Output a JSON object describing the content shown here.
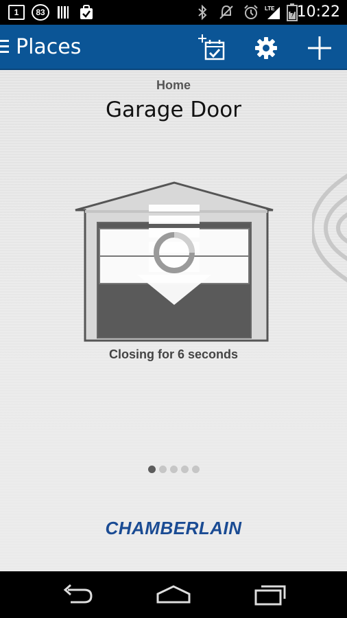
{
  "status_bar": {
    "calendar_day": "1",
    "notification_count": "83",
    "network_label": "LTE",
    "time": "10:22"
  },
  "action_bar": {
    "title": "Places"
  },
  "main": {
    "place_name": "Home",
    "device_name": "Garage Door",
    "status_message": "Closing for 6 seconds",
    "door_state": "closing",
    "page_count": 5,
    "active_page": 1
  },
  "brand": {
    "logo_text": "CHAMBERLAIN"
  },
  "colors": {
    "action_bar": "#0b5596",
    "brand_blue": "#1a4b93",
    "background": "#e6e6e6"
  },
  "icons": {
    "action_bar": [
      "menu-icon",
      "add-schedule-icon",
      "gear-icon",
      "plus-icon"
    ],
    "nav_bar": [
      "back-icon",
      "home-icon",
      "recent-apps-icon"
    ]
  }
}
